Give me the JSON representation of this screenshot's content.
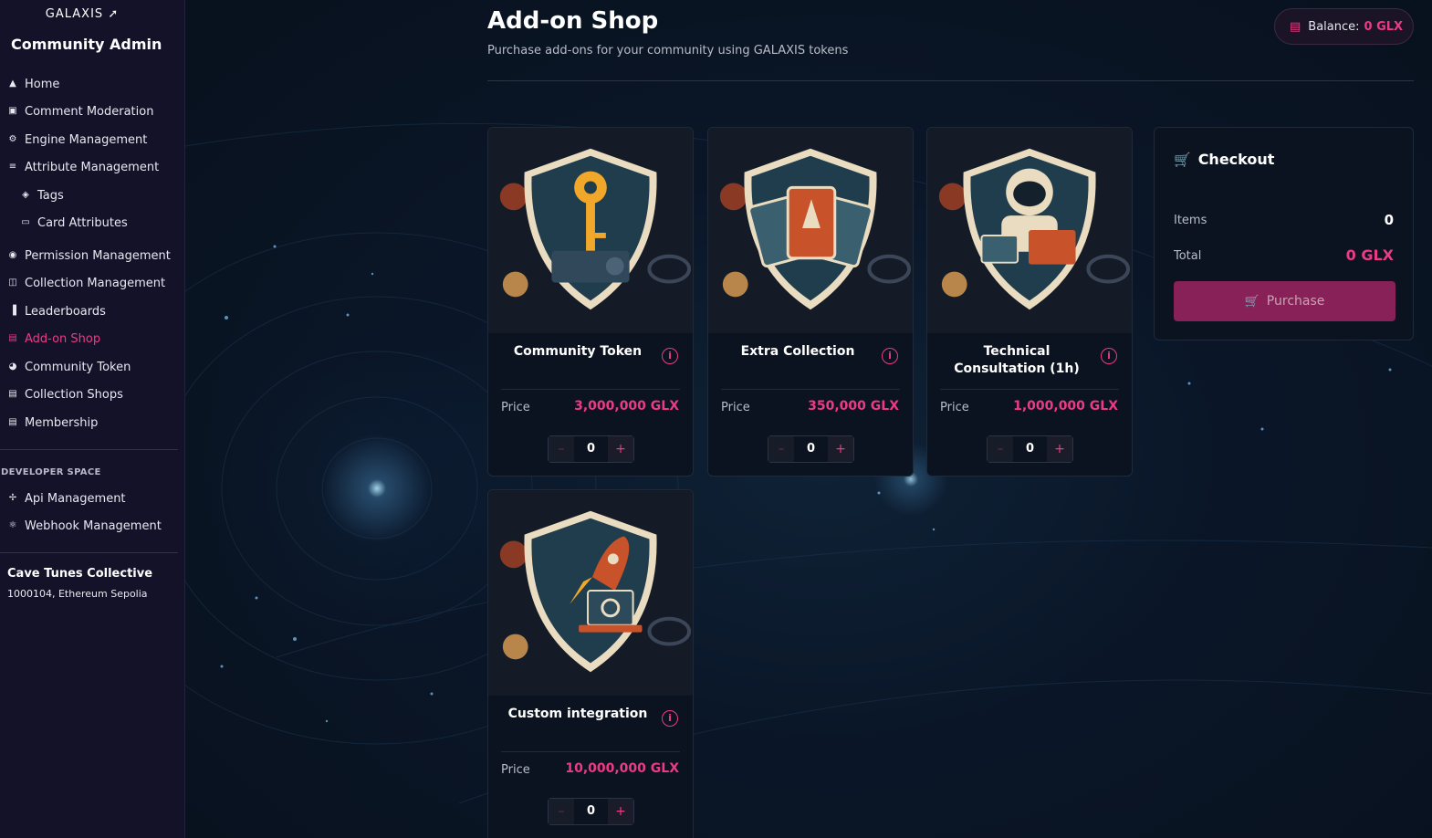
{
  "sidebar": {
    "logo": "GALAXIS",
    "title": "Community Admin",
    "items": [
      {
        "label": "Home",
        "icon": "home-icon"
      },
      {
        "label": "Comment Moderation",
        "icon": "comment-icon"
      },
      {
        "label": "Engine Management",
        "icon": "gear-icon"
      },
      {
        "label": "Attribute Management",
        "icon": "sliders-icon"
      },
      {
        "label": "Tags",
        "icon": "tag-icon"
      },
      {
        "label": "Card Attributes",
        "icon": "card-icon"
      },
      {
        "label": "Permission Management",
        "icon": "shield-icon"
      },
      {
        "label": "Collection Management",
        "icon": "collection-icon"
      },
      {
        "label": "Leaderboards",
        "icon": "bar-chart-icon"
      },
      {
        "label": "Add-on Shop",
        "icon": "shop-icon"
      },
      {
        "label": "Community Token",
        "icon": "token-icon"
      },
      {
        "label": "Collection Shops",
        "icon": "store-icon"
      },
      {
        "label": "Membership",
        "icon": "membership-icon"
      }
    ],
    "developer_space": "DEVELOPER SPACE",
    "dev_items": [
      {
        "label": "Api Management",
        "icon": "api-icon"
      },
      {
        "label": "Webhook Management",
        "icon": "webhook-icon"
      }
    ],
    "community_name": "Cave Tunes Collective",
    "community_sub": "1000104, Ethereum Sepolia",
    "active_item": "Add-on Shop"
  },
  "header": {
    "title": "Add-on Shop",
    "subtitle": "Purchase add-ons for your community using GALAXIS tokens",
    "balance_label": "Balance:",
    "balance_value": "0 GLX"
  },
  "products": [
    {
      "name": "Community Token",
      "price_label": "Price",
      "price": "3,000,000 GLX",
      "qty": "0",
      "image": "key-shield-icon"
    },
    {
      "name": "Extra Collection",
      "price_label": "Price",
      "price": "350,000 GLX",
      "qty": "0",
      "image": "cards-shield-icon"
    },
    {
      "name": "Technical Consultation (1h)",
      "price_label": "Price",
      "price": "1,000,000 GLX",
      "qty": "0",
      "image": "astronaut-shield-icon"
    },
    {
      "name": "Custom integration",
      "price_label": "Price",
      "price": "10,000,000 GLX",
      "qty": "0",
      "image": "rocket-shield-icon"
    }
  ],
  "checkout": {
    "title": "Checkout",
    "items_label": "Items",
    "items_value": "0",
    "total_label": "Total",
    "total_value": "0 GLX",
    "purchase_label": "Purchase"
  },
  "colors": {
    "accent": "#ec3b85",
    "sidebar_bg": "#131229",
    "button_bg": "#872158"
  }
}
